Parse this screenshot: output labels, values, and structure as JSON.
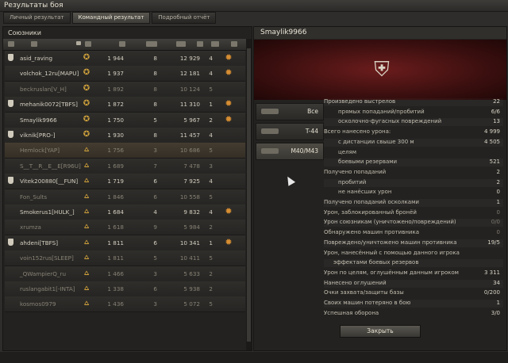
{
  "window": {
    "title": "Результаты боя"
  },
  "tabs": [
    {
      "label": "Личный результат"
    },
    {
      "label": "Командный результат"
    },
    {
      "label": "Подробный отчёт"
    }
  ],
  "allies": {
    "header": "Союзники",
    "columns": [
      "mark-icon",
      "player-icon",
      "sort-chevron-icon",
      "medal-icon",
      "star-icon",
      "tank-icon",
      "damage-icon",
      "kills-icon",
      "hits-icon",
      "award-icon"
    ],
    "rows": [
      {
        "name": "asid_raving",
        "rating": "1 944",
        "stat2": "8",
        "dmg": "12 929",
        "kills": "4",
        "badge": "clan",
        "marked": true,
        "medal": true,
        "dead": false
      },
      {
        "name": "volchok_12ru[MAPU]",
        "rating": "1 937",
        "stat2": "8",
        "dmg": "12 181",
        "kills": "4",
        "badge": "clan",
        "marked": false,
        "medal": true,
        "dead": false
      },
      {
        "name": "beckruslan[V_H]",
        "rating": "1 892",
        "stat2": "8",
        "dmg": "10 124",
        "kills": "5",
        "badge": "clan",
        "marked": false,
        "medal": false,
        "dead": true
      },
      {
        "name": "mehanik0072[TBFS]",
        "rating": "1 872",
        "stat2": "8",
        "dmg": "11 310",
        "kills": "1",
        "badge": "clan",
        "marked": true,
        "medal": true,
        "dead": false
      },
      {
        "name": "Smaylik9966",
        "rating": "1 750",
        "stat2": "5",
        "dmg": "5 967",
        "kills": "2",
        "badge": "clan",
        "marked": false,
        "medal": true,
        "dead": false
      },
      {
        "name": "viknik[PRO-]",
        "rating": "1 930",
        "stat2": "8",
        "dmg": "11 457",
        "kills": "4",
        "badge": "clan",
        "marked": true,
        "medal": false,
        "dead": false
      },
      {
        "name": "Hemlock[YAP]",
        "rating": "1 756",
        "stat2": "3",
        "dmg": "10 686",
        "kills": "5",
        "badge": "rank",
        "marked": false,
        "medal": false,
        "dead": true,
        "selected": true
      },
      {
        "name": "S__T__R__E__E[R96U]",
        "rating": "1 689",
        "stat2": "7",
        "dmg": "7 478",
        "kills": "3",
        "badge": "rank",
        "marked": false,
        "medal": false,
        "dead": true
      },
      {
        "name": "Vitek200880[__FUN]",
        "rating": "1 719",
        "stat2": "6",
        "dmg": "7 925",
        "kills": "4",
        "badge": "rank",
        "marked": true,
        "medal": false,
        "dead": false
      },
      {
        "name": "Fon_Sults",
        "rating": "1 846",
        "stat2": "6",
        "dmg": "10 558",
        "kills": "5",
        "badge": "rank",
        "marked": false,
        "medal": false,
        "dead": true
      },
      {
        "name": "Smokerus1[HULK_]",
        "rating": "1 684",
        "stat2": "4",
        "dmg": "9 832",
        "kills": "4",
        "badge": "rank",
        "marked": false,
        "medal": true,
        "dead": false
      },
      {
        "name": "xrumza",
        "rating": "1 618",
        "stat2": "9",
        "dmg": "5 984",
        "kills": "2",
        "badge": "rank",
        "marked": false,
        "medal": false,
        "dead": true
      },
      {
        "name": "ahdeni[TBFS]",
        "rating": "1 811",
        "stat2": "6",
        "dmg": "10 341",
        "kills": "1",
        "badge": "rank",
        "marked": true,
        "medal": true,
        "dead": false
      },
      {
        "name": "voin152rus[SLEEP]",
        "rating": "1 811",
        "stat2": "5",
        "dmg": "10 411",
        "kills": "5",
        "badge": "rank",
        "marked": false,
        "medal": false,
        "dead": true
      },
      {
        "name": "_QWampierQ_ru",
        "rating": "1 466",
        "stat2": "3",
        "dmg": "5 633",
        "kills": "2",
        "badge": "rank",
        "marked": false,
        "medal": false,
        "dead": true
      },
      {
        "name": "ruslangabit1[-INTA]",
        "rating": "1 338",
        "stat2": "6",
        "dmg": "5 938",
        "kills": "2",
        "badge": "rank",
        "marked": false,
        "medal": false,
        "dead": true
      },
      {
        "name": "kosmos0979",
        "rating": "1 436",
        "stat2": "3",
        "dmg": "5 072",
        "kills": "5",
        "badge": "rank",
        "marked": false,
        "medal": false,
        "dead": true
      }
    ]
  },
  "detail": {
    "player": "Smaylik9966",
    "vehicles": [
      {
        "label": "Все"
      },
      {
        "label": "T-44"
      },
      {
        "label": "M40/M43"
      }
    ],
    "stats": [
      {
        "label": "Произведено выстрелов",
        "value": "22",
        "indent": 0
      },
      {
        "label": "прямых попаданий/пробитий",
        "value": "6/6",
        "indent": 1
      },
      {
        "label": "осколочно-фугасных повреждений",
        "value": "13",
        "indent": 1
      },
      {
        "label": "Всего нанесено урона:",
        "value": "4 999",
        "indent": 0
      },
      {
        "label": "с дистанции свыше 300 м",
        "value": "4 505",
        "indent": 1
      },
      {
        "label": "целям",
        "value": "",
        "indent": 1
      },
      {
        "label": "боевыми резервами",
        "value": "521",
        "indent": 1
      },
      {
        "label": "Получено попаданий",
        "value": "2",
        "indent": 0
      },
      {
        "label": "пробитий",
        "value": "2",
        "indent": 1
      },
      {
        "label": "не нанёсших урон",
        "value": "0",
        "indent": 1
      },
      {
        "label": "Получено попаданий осколками",
        "value": "1",
        "indent": 0
      },
      {
        "label": "Урон, заблокированный бронёй",
        "value": "0",
        "indent": 0,
        "gray": true
      },
      {
        "label": "Урон союзникам (уничтожено/повреждений)",
        "value": "0/0",
        "indent": 0,
        "gray": true
      },
      {
        "label": "Обнаружено машин противника",
        "value": "0",
        "indent": 0,
        "gray": true
      },
      {
        "label": "Повреждено/уничтожено машин противника",
        "value": "19/5",
        "indent": 0
      },
      {
        "label": "Урон, нанесённый с помощью данного игрока",
        "value": "",
        "indent": 0
      },
      {
        "label": "эффектами боевых резервов",
        "value": "",
        "indent": 2
      },
      {
        "label": "Урон по целям, оглушённым данным игроком",
        "value": "3 311",
        "indent": 0
      },
      {
        "label": "Нанесено оглушений",
        "value": "34",
        "indent": 0
      },
      {
        "label": "Очки захвата/защиты базы",
        "value": "0/200",
        "indent": 0
      },
      {
        "label": "Своих машин потеряно в бою",
        "value": "1",
        "indent": 0
      },
      {
        "label": "Успешная оборона",
        "value": "3/0",
        "indent": 0
      }
    ],
    "close_label": "Закрыть"
  }
}
